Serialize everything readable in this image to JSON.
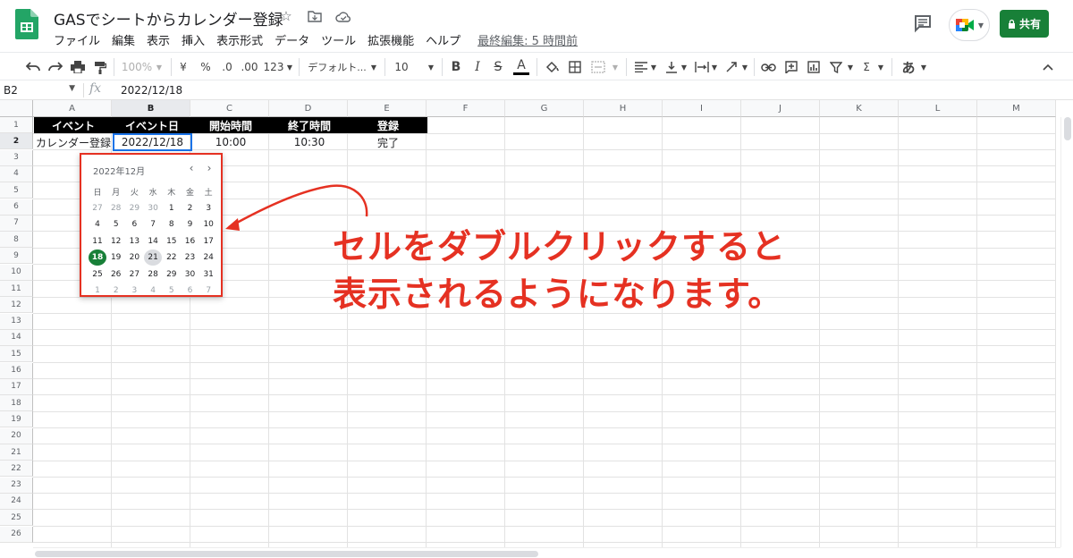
{
  "doc": {
    "title": "GASでシートからカレンダー登録",
    "last_edit": "最終編集: 5 時間前"
  },
  "menu": [
    "ファイル",
    "編集",
    "表示",
    "挿入",
    "表示形式",
    "データ",
    "ツール",
    "拡張機能",
    "ヘルプ"
  ],
  "share": {
    "label": "共有"
  },
  "toolbar": {
    "zoom": "100%",
    "currency": "¥",
    "percent": "%",
    "dec_decrease": ".0",
    "dec_increase": ".00",
    "number_format": "123",
    "font": "デフォルト...",
    "font_size": "10",
    "bold": "B",
    "italic": "I",
    "strike": "S",
    "text_color": "A",
    "sigma": "Σ",
    "input_tool": "あ"
  },
  "formula_bar": {
    "cell_ref": "B2",
    "fx": "fx",
    "value": "2022/12/18"
  },
  "columns": [
    "A",
    "B",
    "C",
    "D",
    "E",
    "F",
    "G",
    "H",
    "I",
    "J",
    "K",
    "L",
    "M"
  ],
  "rows": [
    "1",
    "2",
    "3",
    "4",
    "5",
    "6",
    "7",
    "8",
    "9",
    "10",
    "11",
    "12",
    "13",
    "14",
    "15",
    "16",
    "17",
    "18",
    "19",
    "20",
    "21",
    "22",
    "23",
    "24",
    "25",
    "26"
  ],
  "sheet": {
    "headers": [
      "イベント",
      "イベント日",
      "開始時間",
      "終了時間",
      "登録"
    ],
    "row2": [
      "カレンダー登録",
      "2022/12/18",
      "10:00",
      "10:30",
      "完了"
    ]
  },
  "datepicker": {
    "title": "2022年12月",
    "prev": "‹",
    "next": "›",
    "weekdays": [
      "日",
      "月",
      "火",
      "水",
      "木",
      "金",
      "土"
    ],
    "weeks": [
      [
        "27",
        "28",
        "29",
        "30",
        "1",
        "2",
        "3"
      ],
      [
        "4",
        "5",
        "6",
        "7",
        "8",
        "9",
        "10"
      ],
      [
        "11",
        "12",
        "13",
        "14",
        "15",
        "16",
        "17"
      ],
      [
        "18",
        "19",
        "20",
        "21",
        "22",
        "23",
        "24"
      ],
      [
        "25",
        "26",
        "27",
        "28",
        "29",
        "30",
        "31"
      ],
      [
        "1",
        "2",
        "3",
        "4",
        "5",
        "6",
        "7"
      ]
    ],
    "selected": "18",
    "today": "21"
  },
  "annotation": {
    "line1": "セルをダブルクリックすると",
    "line2": "表示されるようになります。",
    "color": "#e53122"
  },
  "colors": {
    "brand_green": "#188038",
    "selection_blue": "#1a73e8"
  }
}
